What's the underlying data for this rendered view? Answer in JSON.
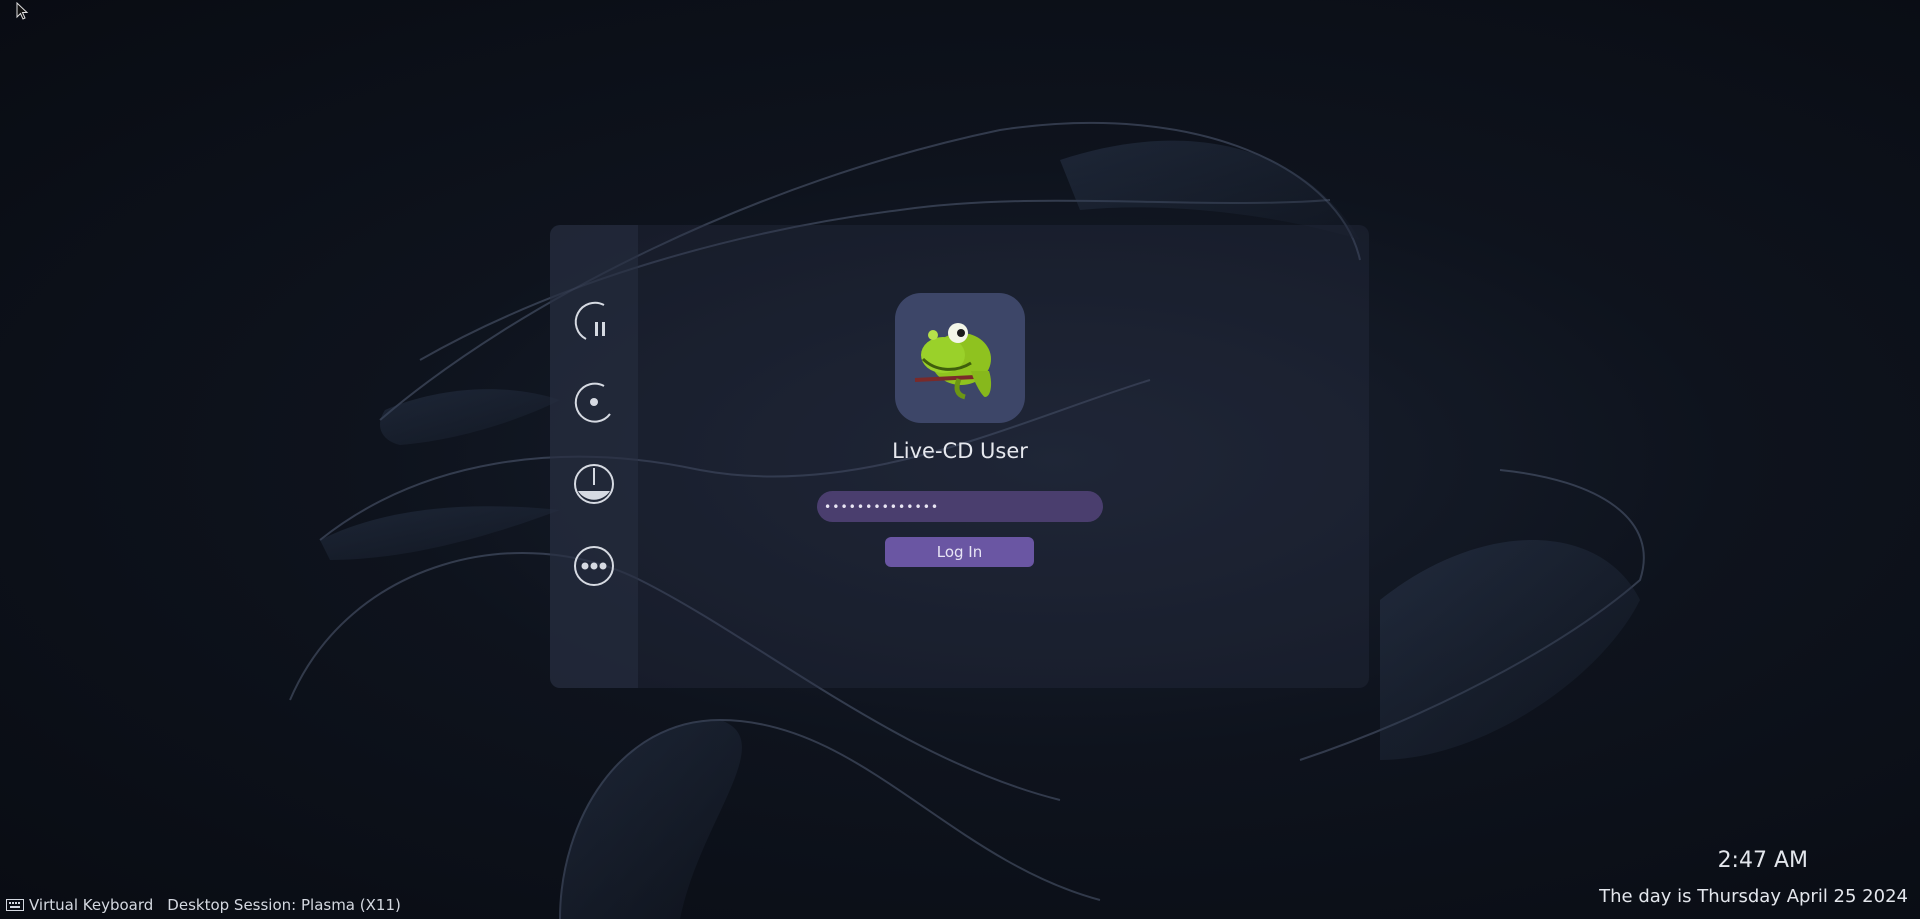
{
  "greeter": {
    "username": "Live-CD User",
    "password_masked": "••••••••••••••",
    "login_label": "Log In",
    "avatar_icon": "chameleon-avatar-icon"
  },
  "actions": [
    {
      "icon": "suspend-icon"
    },
    {
      "icon": "hibernate-icon"
    },
    {
      "icon": "shutdown-icon"
    },
    {
      "icon": "more-options-icon"
    }
  ],
  "footer": {
    "virtual_keyboard_label": "Virtual Keyboard",
    "session_label": "Desktop Session: Plasma (X11)"
  },
  "clock": {
    "time": "2:47 AM",
    "date": "The day is Thursday April 25 2024"
  },
  "colors": {
    "accent": "#6a56a3",
    "password_bg": "#4a3e6e",
    "avatar_bg": "#3d4668",
    "text": "#e3e6ec"
  }
}
